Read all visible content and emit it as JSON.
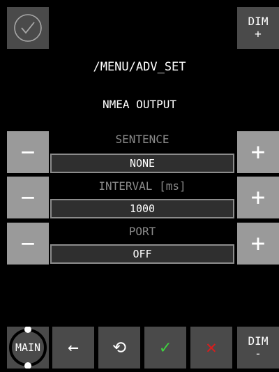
{
  "header": {
    "dim_plus_top": "DIM",
    "dim_plus_sign": "+"
  },
  "breadcrumb": "/MENU/ADV_SET",
  "section_title": "NMEA OUTPUT",
  "settings": [
    {
      "label": "SENTENCE",
      "value": "NONE",
      "minus": "−",
      "plus": "+"
    },
    {
      "label": "INTERVAL [ms]",
      "value": "1000",
      "minus": "−",
      "plus": "+"
    },
    {
      "label": "PORT",
      "value": "OFF",
      "minus": "−",
      "plus": "+"
    }
  ],
  "bottom_bar": {
    "main_label": "MAIN",
    "back_symbol": "←",
    "reset_symbol": "⟲",
    "ok_symbol": "✓",
    "cancel_symbol": "✕",
    "dim_minus_top": "DIM",
    "dim_minus_sign": "-"
  },
  "colors": {
    "ok": "#3fd23f",
    "cancel": "#d61e1e",
    "button_dark": "#4a4a4a",
    "button_light": "#9a9a9a"
  }
}
